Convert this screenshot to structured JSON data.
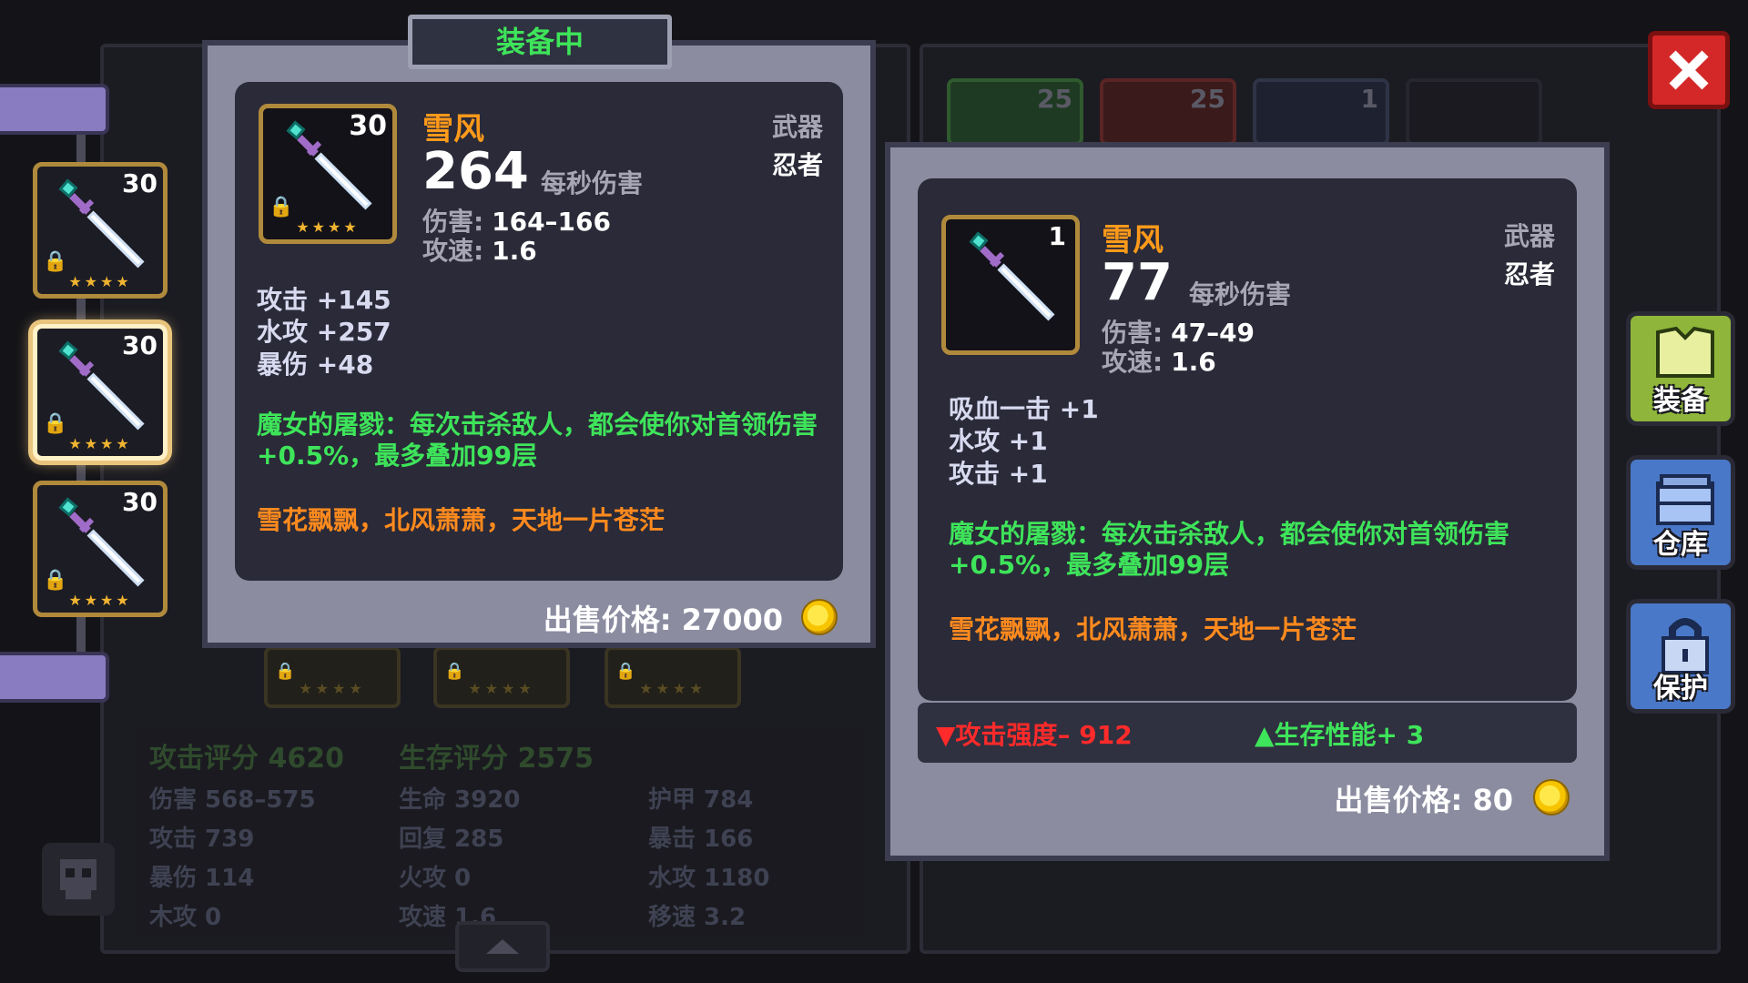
{
  "equipped_tab": "装备中",
  "equipped_item": {
    "name": "雪风",
    "level": "30",
    "dps": "264",
    "dps_label": "每秒伤害",
    "type": "武器",
    "class": "忍者",
    "damage_label": "伤害:",
    "damage": "164–166",
    "speed_label": "攻速:",
    "speed": "1.6",
    "stats": [
      "攻击 +145",
      "水攻 +257",
      "暴伤 +48"
    ],
    "skill": "魔女的屠戮：每次击杀敌人，都会使你对首领伤害+0.5%，最多叠加99层",
    "flavor": "雪花飘飘，北风萧萧，天地一片苍茫",
    "sell_label": "出售价格: 27000",
    "stars": "★★★★"
  },
  "compare_item": {
    "name": "雪风",
    "level": "1",
    "dps": "77",
    "dps_label": "每秒伤害",
    "type": "武器",
    "class": "忍者",
    "damage_label": "伤害:",
    "damage": "47–49",
    "speed_label": "攻速:",
    "speed": "1.6",
    "stats": [
      "吸血一击 +1",
      "水攻 +1",
      "攻击 +1"
    ],
    "skill": "魔女的屠戮：每次击杀敌人，都会使你对首领伤害+0.5%，最多叠加99层",
    "flavor": "雪花飘飘，北风萧萧，天地一片苍茫",
    "attack_change": "攻击强度– 912",
    "survival_change": "生存性能+ 3",
    "sell_label": "出售价格: 80"
  },
  "left_slots": [
    {
      "level": "30",
      "stars": "★★★★"
    },
    {
      "level": "30",
      "stars": "★★★★"
    },
    {
      "level": "30",
      "stars": "★★★★"
    }
  ],
  "bg_tabs": [
    "25",
    "25",
    "1"
  ],
  "stats_panel": {
    "attack_score": "攻击评分 4620",
    "survival_score": "生存评分 2575",
    "rows": [
      [
        "伤害 568–575",
        "生命 3920",
        "护甲 784"
      ],
      [
        "攻击 739",
        "回复 285",
        "暴击 166"
      ],
      [
        "暴伤 114",
        "火攻 0",
        "水攻 1180"
      ],
      [
        "木攻 0",
        "攻速 1.6",
        "移速 3.2"
      ]
    ]
  },
  "side_buttons": {
    "equip": "装备",
    "storage": "仓库",
    "protect": "保护"
  },
  "icons": {
    "weapon": "sword-icon",
    "lock": "lock-icon",
    "coin": "coin-icon",
    "close": "close-icon",
    "up": "chevron-up-icon",
    "skull": "skull-icon"
  }
}
